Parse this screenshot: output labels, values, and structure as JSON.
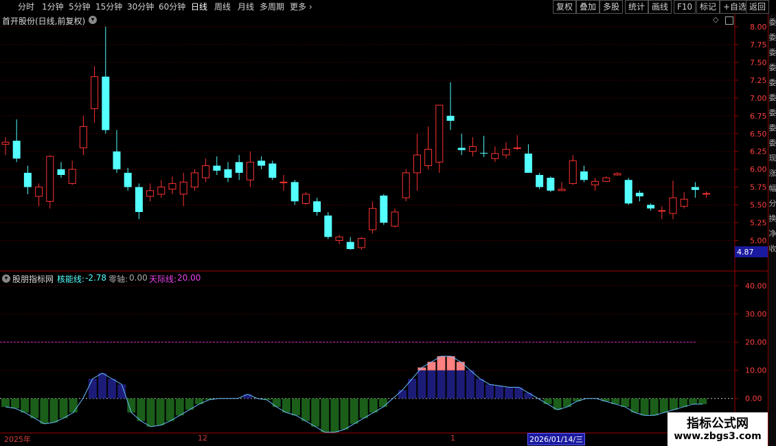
{
  "toolbar": {
    "periods": [
      "分时",
      "1分钟",
      "5分钟",
      "15分钟",
      "30分钟",
      "60分钟",
      "日线",
      "周线",
      "月线",
      "多周期",
      "更多"
    ],
    "active_period": "日线",
    "right_buttons": [
      "复权",
      "叠加",
      "多股",
      "统计",
      "画线",
      "F10",
      "标记",
      "+自选",
      "返回"
    ]
  },
  "main_chart": {
    "title": "首开股份(日线,前复权)",
    "price_labels": [
      "8.00",
      "7.75",
      "7.50",
      "7.25",
      "7.00",
      "6.75",
      "6.50",
      "6.25",
      "6.00",
      "5.75",
      "5.50",
      "5.25",
      "5.00"
    ],
    "current_price": "4.87"
  },
  "indicator": {
    "name": "股朋指标网",
    "line1_label": "核能线:",
    "line1_value": "-2.78",
    "line2_label": "零轴:",
    "line2_value": "0.00",
    "line3_label": "天际线:",
    "line3_value": "20.00",
    "axis_labels": [
      "40.00",
      "30.00",
      "20.00",
      "10.00",
      "0.00"
    ]
  },
  "time_axis": {
    "labels": [
      "2025年",
      "12",
      "1"
    ],
    "cursor_date": "2026/01/14/三"
  },
  "sidebar": {
    "chars": [
      "委",
      "委",
      "委",
      "委",
      "委",
      "委",
      "委",
      "委",
      "委",
      "现",
      "涨",
      "幅",
      "分",
      "换",
      "净",
      "收"
    ]
  },
  "watermark": {
    "line1": "指标公式网",
    "line2": "www.zbgs3.com"
  },
  "colors": {
    "up": "#ff3232",
    "down": "#54ffff",
    "hist_neg": "#1a5e1a",
    "hist_pos": "#1c1c78",
    "hist_hot": "#ff8080",
    "line": "#6ac0ff",
    "sky": "#cc33cc"
  },
  "chart_data": [
    {
      "type": "candlestick",
      "title": "首开股份(日线,前复权)",
      "ylim": [
        4.87,
        8.0
      ],
      "candles": [
        {
          "o": 6.35,
          "c": 6.38,
          "h": 6.45,
          "l": 6.2
        },
        {
          "o": 6.4,
          "c": 6.15,
          "h": 6.7,
          "l": 6.1
        },
        {
          "o": 5.95,
          "c": 5.75,
          "h": 6.05,
          "l": 5.65
        },
        {
          "o": 5.62,
          "c": 5.75,
          "h": 5.8,
          "l": 5.48
        },
        {
          "o": 5.55,
          "c": 6.18,
          "h": 6.2,
          "l": 5.45
        },
        {
          "o": 6.0,
          "c": 5.92,
          "h": 6.1,
          "l": 5.88
        },
        {
          "o": 5.8,
          "c": 6.0,
          "h": 6.12,
          "l": 5.78
        },
        {
          "o": 6.3,
          "c": 6.6,
          "h": 6.75,
          "l": 6.2
        },
        {
          "o": 6.85,
          "c": 7.3,
          "h": 7.45,
          "l": 6.65
        },
        {
          "o": 7.3,
          "c": 6.55,
          "h": 8.0,
          "l": 6.5
        },
        {
          "o": 6.25,
          "c": 6.0,
          "h": 6.55,
          "l": 5.95
        },
        {
          "o": 5.95,
          "c": 5.75,
          "h": 6.02,
          "l": 5.7
        },
        {
          "o": 5.75,
          "c": 5.4,
          "h": 5.8,
          "l": 5.3
        },
        {
          "o": 5.62,
          "c": 5.7,
          "h": 5.8,
          "l": 5.55
        },
        {
          "o": 5.65,
          "c": 5.75,
          "h": 5.85,
          "l": 5.6
        },
        {
          "o": 5.72,
          "c": 5.8,
          "h": 5.9,
          "l": 5.65
        },
        {
          "o": 5.65,
          "c": 5.82,
          "h": 5.95,
          "l": 5.48
        },
        {
          "o": 5.75,
          "c": 5.95,
          "h": 6.0,
          "l": 5.7
        },
        {
          "o": 5.88,
          "c": 6.05,
          "h": 6.15,
          "l": 5.82
        },
        {
          "o": 6.05,
          "c": 5.98,
          "h": 6.18,
          "l": 5.92
        },
        {
          "o": 6.0,
          "c": 5.88,
          "h": 6.1,
          "l": 5.82
        },
        {
          "o": 6.1,
          "c": 5.95,
          "h": 6.2,
          "l": 5.85
        },
        {
          "o": 5.85,
          "c": 6.1,
          "h": 6.25,
          "l": 5.75
        },
        {
          "o": 6.12,
          "c": 6.05,
          "h": 6.18,
          "l": 6.0
        },
        {
          "o": 6.08,
          "c": 5.88,
          "h": 6.12,
          "l": 5.85
        },
        {
          "o": 5.82,
          "c": 5.82,
          "h": 5.92,
          "l": 5.7
        },
        {
          "o": 5.82,
          "c": 5.55,
          "h": 5.85,
          "l": 5.5
        },
        {
          "o": 5.52,
          "c": 5.65,
          "h": 5.68,
          "l": 5.5
        },
        {
          "o": 5.55,
          "c": 5.4,
          "h": 5.6,
          "l": 5.35
        },
        {
          "o": 5.35,
          "c": 5.05,
          "h": 5.4,
          "l": 5.02
        },
        {
          "o": 5.0,
          "c": 5.05,
          "h": 5.08,
          "l": 4.95
        },
        {
          "o": 4.98,
          "c": 4.88,
          "h": 5.05,
          "l": 4.87
        },
        {
          "o": 4.9,
          "c": 5.03,
          "h": 5.05,
          "l": 4.87
        },
        {
          "o": 5.15,
          "c": 5.45,
          "h": 5.55,
          "l": 5.1
        },
        {
          "o": 5.63,
          "c": 5.25,
          "h": 5.65,
          "l": 5.22
        },
        {
          "o": 5.2,
          "c": 5.4,
          "h": 5.45,
          "l": 5.18
        },
        {
          "o": 5.6,
          "c": 5.95,
          "h": 6.0,
          "l": 5.55
        },
        {
          "o": 5.95,
          "c": 6.2,
          "h": 6.5,
          "l": 5.7
        },
        {
          "o": 6.05,
          "c": 6.28,
          "h": 6.6,
          "l": 6.0
        },
        {
          "o": 6.1,
          "c": 6.9,
          "h": 6.9,
          "l": 5.95
        },
        {
          "o": 6.75,
          "c": 6.68,
          "h": 7.22,
          "l": 6.55
        },
        {
          "o": 6.3,
          "c": 6.27,
          "h": 6.5,
          "l": 6.2
        },
        {
          "o": 6.25,
          "c": 6.32,
          "h": 6.45,
          "l": 6.18
        },
        {
          "o": 6.23,
          "c": 6.22,
          "h": 6.47,
          "l": 6.17
        },
        {
          "o": 6.15,
          "c": 6.22,
          "h": 6.32,
          "l": 6.1
        },
        {
          "o": 6.2,
          "c": 6.28,
          "h": 6.38,
          "l": 6.15
        },
        {
          "o": 6.3,
          "c": 6.3,
          "h": 6.48,
          "l": 6.27
        },
        {
          "o": 6.22,
          "c": 5.95,
          "h": 6.35,
          "l": 5.95
        },
        {
          "o": 5.92,
          "c": 5.75,
          "h": 5.95,
          "l": 5.72
        },
        {
          "o": 5.88,
          "c": 5.7,
          "h": 5.9,
          "l": 5.68
        },
        {
          "o": 5.7,
          "c": 5.72,
          "h": 5.82,
          "l": 5.7
        },
        {
          "o": 5.8,
          "c": 6.12,
          "h": 6.2,
          "l": 5.78
        },
        {
          "o": 5.97,
          "c": 5.85,
          "h": 6.05,
          "l": 5.82
        },
        {
          "o": 5.78,
          "c": 5.83,
          "h": 5.88,
          "l": 5.7
        },
        {
          "o": 5.83,
          "c": 5.88,
          "h": 5.9,
          "l": 5.82
        },
        {
          "o": 5.92,
          "c": 5.94,
          "h": 5.96,
          "l": 5.91
        },
        {
          "o": 5.85,
          "c": 5.52,
          "h": 5.88,
          "l": 5.5
        },
        {
          "o": 5.67,
          "c": 5.62,
          "h": 5.7,
          "l": 5.55
        },
        {
          "o": 5.5,
          "c": 5.45,
          "h": 5.52,
          "l": 5.42
        },
        {
          "o": 5.42,
          "c": 5.42,
          "h": 5.48,
          "l": 5.3
        },
        {
          "o": 5.38,
          "c": 5.6,
          "h": 5.84,
          "l": 5.3
        },
        {
          "o": 5.48,
          "c": 5.58,
          "h": 5.68,
          "l": 5.45
        },
        {
          "o": 5.75,
          "c": 5.71,
          "h": 5.82,
          "l": 5.6
        },
        {
          "o": 5.66,
          "c": 5.66,
          "h": 5.69,
          "l": 5.6
        }
      ]
    },
    {
      "type": "bar",
      "title": "股朋指标网",
      "ylim": [
        -12,
        45
      ],
      "values": [
        -3,
        -3.5,
        -5,
        -7,
        -9,
        -8.5,
        -7,
        -5,
        0,
        7,
        9,
        7,
        5,
        -5,
        -8,
        -10,
        -9.5,
        -8,
        -6,
        -4,
        -2,
        -0.5,
        0,
        0,
        0,
        1.5,
        0,
        -0.5,
        -3,
        -5,
        -6,
        -8,
        -10,
        -12,
        -12,
        -11,
        -9,
        -7,
        -5,
        -3,
        0,
        3,
        7,
        11,
        13,
        15,
        15,
        13,
        10,
        7,
        5,
        4.5,
        4,
        4,
        2,
        0,
        -2,
        -4,
        -3,
        -1,
        0,
        0,
        -1,
        -2,
        -3,
        -5,
        -6,
        -6,
        -5,
        -4,
        -3,
        -2,
        -2
      ]
    }
  ]
}
